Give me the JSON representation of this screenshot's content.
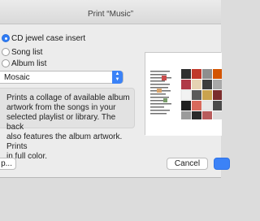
{
  "window": {
    "title": "Print “Music”"
  },
  "options": [
    {
      "label": "CD jewel case insert",
      "selected": true
    },
    {
      "label": "Song list",
      "selected": false
    },
    {
      "label": "Album list",
      "selected": false
    }
  ],
  "theme": {
    "value": "Mosaic"
  },
  "description": {
    "lines": [
      "Prints a collage of available album",
      "artwork from the songs in your",
      "selected playlist or library. The back",
      "also features the album artwork. Prints",
      "in full color."
    ]
  },
  "buttons": {
    "left_partial": "p...",
    "cancel": "Cancel"
  },
  "colors": {
    "accent": "#3b82f7",
    "dialog_bg": "#ececec"
  }
}
